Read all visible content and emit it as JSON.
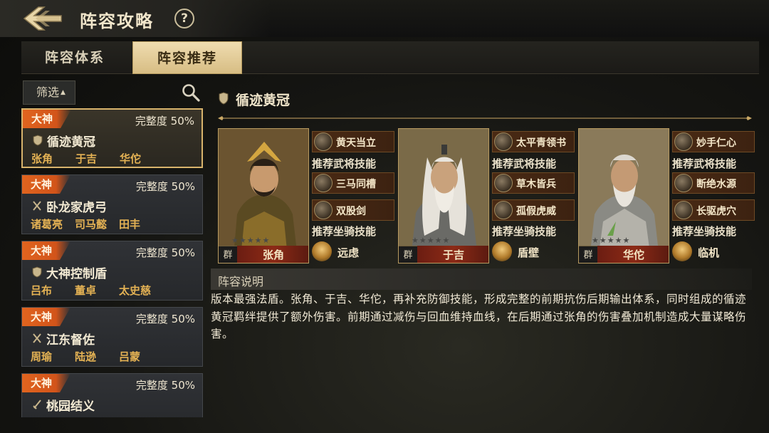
{
  "header": {
    "title": "阵容攻略",
    "help": "?"
  },
  "tabs": [
    {
      "label": "阵容体系",
      "active": false
    },
    {
      "label": "阵容推荐",
      "active": true
    }
  ],
  "filter": {
    "label": "筛选"
  },
  "lineups": [
    {
      "tag": "大神",
      "completeness": "完整度 50%",
      "name": "循迹黄冠",
      "icon": "shield-icon",
      "heroes": [
        "张角",
        "于吉",
        "华佗"
      ],
      "active": true
    },
    {
      "tag": "大神",
      "completeness": "完整度 50%",
      "name": "卧龙家虎弓",
      "icon": "crossed-swords-icon",
      "heroes": [
        "诸葛亮",
        "司马懿",
        "田丰"
      ],
      "active": false
    },
    {
      "tag": "大神",
      "completeness": "完整度 50%",
      "name": "大神控制盾",
      "icon": "shield-icon",
      "heroes": [
        "吕布",
        "董卓",
        "太史慈"
      ],
      "active": false
    },
    {
      "tag": "大神",
      "completeness": "完整度 50%",
      "name": "江东督佐",
      "icon": "crossed-swords-icon",
      "heroes": [
        "周瑜",
        "陆逊",
        "吕蒙"
      ],
      "active": false
    },
    {
      "tag": "大神",
      "completeness": "完整度 50%",
      "name": "桃园结义",
      "icon": "sword-icon",
      "heroes": [
        "",
        "",
        ""
      ],
      "active": false
    }
  ],
  "detail": {
    "title": "循迹黄冠",
    "skill_label": "推荐武将技能",
    "mount_label": "推荐坐骑技能",
    "heroes": [
      {
        "name": "张角",
        "faction": "群",
        "skills": [
          "黄天当立",
          "三马同槽",
          "双股剑"
        ],
        "mount": "远虑"
      },
      {
        "name": "于吉",
        "faction": "群",
        "skills": [
          "太平青领书",
          "草木皆兵",
          "孤假虎威"
        ],
        "mount": "盾壁"
      },
      {
        "name": "华佗",
        "faction": "群",
        "skills": [
          "妙手仁心",
          "断绝水源",
          "长驱虎穴"
        ],
        "mount": "临机"
      }
    ],
    "desc_title": "阵容说明",
    "description": "版本最强法盾。张角、于吉、华佗，再补充防御技能，形成完整的前期抗伤后期输出体系，同时组成的循迹黄冠羁绊提供了额外伤害。前期通过减伤与回血维持血线，在后期通过张角的伤害叠加机制造成大量谋略伤害。"
  },
  "colors": {
    "accent_gold": "#d8b36c",
    "tag_orange": "#e0641f",
    "hero_gold": "#e4b254"
  }
}
